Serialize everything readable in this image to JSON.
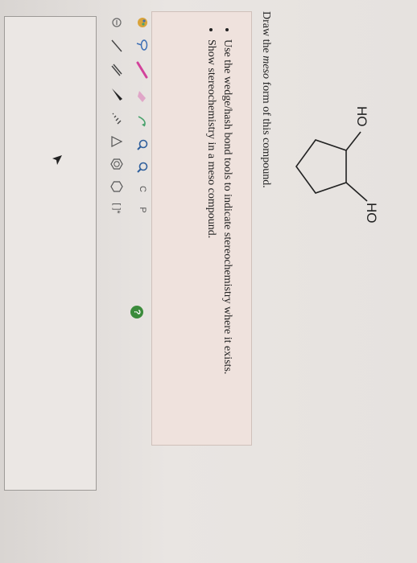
{
  "molecule": {
    "label_top": "HO",
    "label_bottom": "HO"
  },
  "question": {
    "prefix": "Draw the ",
    "emphasis": "meso",
    "suffix": " form of this compound."
  },
  "instructions": [
    "Use the wedge/hash bond tools to indicate stereochemistry where it exists.",
    "Show stereochemistry in a meso compound."
  ],
  "toolbar": {
    "text_tool_label": "C",
    "periodic_tool_label": "P",
    "ring_label": "[ ]*"
  },
  "help": {
    "label": "?"
  },
  "colors": {
    "hint_box": "#efe2dd",
    "help_button": "#3b8b3b",
    "pencil_pink": "#d2429b",
    "tool_green": "#4aa36e",
    "tool_blue": "#3d6fb5"
  }
}
